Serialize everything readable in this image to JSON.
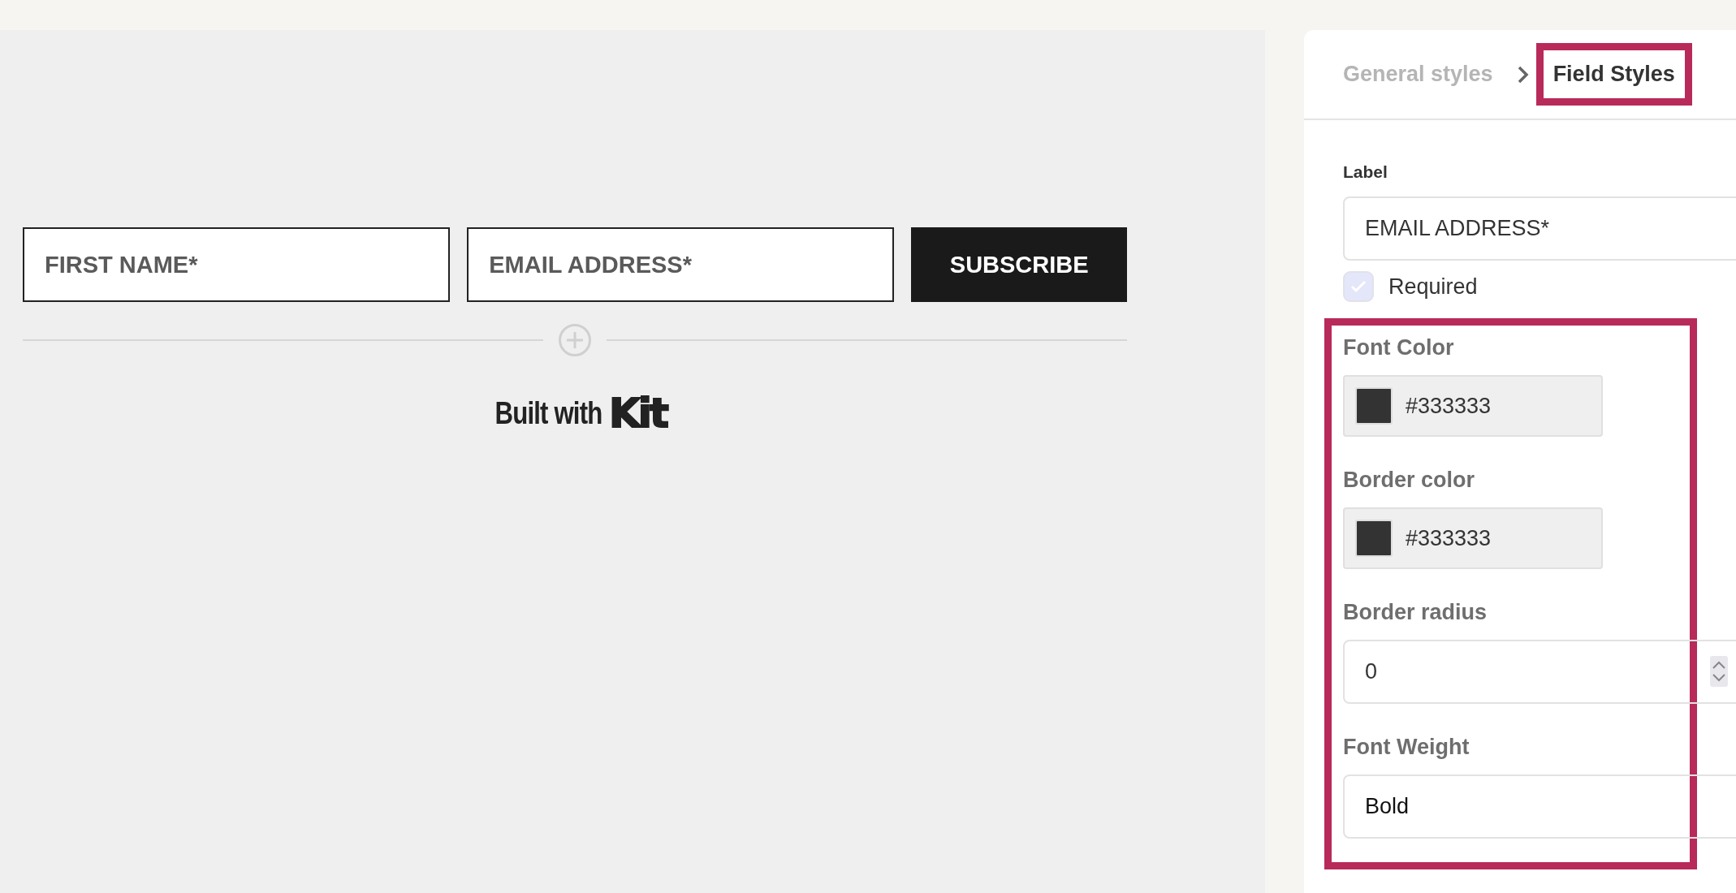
{
  "form_preview": {
    "fields": [
      {
        "placeholder": "FIRST NAME*"
      },
      {
        "placeholder": "EMAIL ADDRESS*"
      }
    ],
    "submit_button": "SUBSCRIBE",
    "footer": {
      "text": "Built with",
      "logo": "Kit"
    }
  },
  "panel": {
    "breadcrumb": [
      {
        "label": "General styles",
        "selected": false,
        "highlighted": false
      },
      {
        "label": "Field Styles",
        "selected": true,
        "highlighted": true
      }
    ],
    "label_field": {
      "label": "Label",
      "value": "EMAIL ADDRESS*"
    },
    "required": {
      "label": "Required",
      "checked": true
    },
    "style_fields": {
      "highlighted": true,
      "items": [
        {
          "kind": "color",
          "label": "Font Color",
          "value": "#333333",
          "color": "#333333"
        },
        {
          "kind": "color",
          "label": "Border color",
          "value": "#333333",
          "color": "#333333"
        },
        {
          "kind": "number",
          "label": "Border radius",
          "value": "0"
        },
        {
          "kind": "select",
          "label": "Font Weight",
          "value": "Bold"
        }
      ]
    }
  }
}
